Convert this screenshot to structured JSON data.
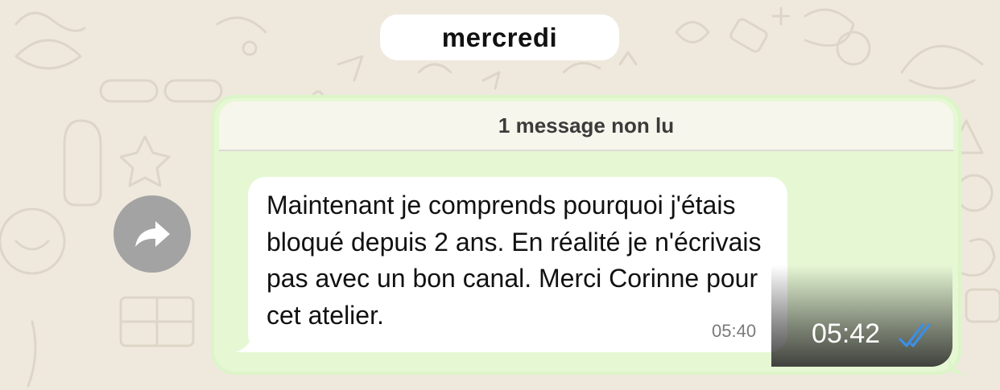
{
  "chat": {
    "date_separator": "mercredi",
    "unread_banner": "1 message non lu"
  },
  "message": {
    "text": "Maintenant je comprends pourquoi j'étais bloqué depuis 2 ans. En réalité je n'écrivais pas avec un bon canal. Merci Corinne pour cet atelier.",
    "time": "05:40"
  },
  "outer_message": {
    "time": "05:42",
    "status": "read"
  },
  "icons": {
    "forward": "forward-arrow-icon",
    "read_receipt": "double-check-icon"
  },
  "colors": {
    "background": "#efe9dd",
    "outgoing_bubble": "#e6f7d4",
    "incoming_bubble": "#ffffff",
    "read_tick": "#3b8fe8",
    "forward_button": "#a3a3a3"
  }
}
